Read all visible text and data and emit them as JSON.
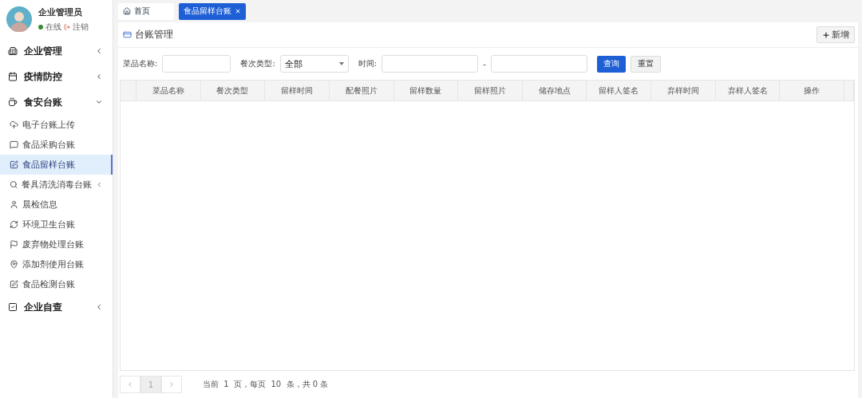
{
  "user": {
    "name": "企业管理员",
    "status": "在线",
    "logout": "注销"
  },
  "menu": [
    {
      "label": "企业管理",
      "expanded": false
    },
    {
      "label": "疫情防控",
      "expanded": false
    },
    {
      "label": "食安台账",
      "expanded": true,
      "children": [
        {
          "label": "电子台账上传",
          "selected": false
        },
        {
          "label": "食品采购台账",
          "selected": false
        },
        {
          "label": "食品留样台账",
          "selected": true
        },
        {
          "label": "餐具清洗消毒台账",
          "selected": false,
          "expanded": false
        },
        {
          "label": "晨检信息",
          "selected": false
        },
        {
          "label": "环境卫生台账",
          "selected": false
        },
        {
          "label": "废弃物处理台账",
          "selected": false
        },
        {
          "label": "添加剂使用台账",
          "selected": false
        },
        {
          "label": "食品检测台账",
          "selected": false
        }
      ]
    },
    {
      "label": "企业自查",
      "expanded": false
    }
  ],
  "tabs": [
    {
      "label": "首页",
      "selected": false
    },
    {
      "label": "食品留样台账",
      "selected": true
    }
  ],
  "panel": {
    "title": "台账管理",
    "add_button": "新增"
  },
  "filters": {
    "dish_label": "菜品名称:",
    "meal_label": "餐次类型:",
    "meal_value": "全部",
    "time_label": "时间:",
    "time_separator": "-",
    "query_button": "查询",
    "reset_button": "重置"
  },
  "table": {
    "columns": [
      "菜品名称",
      "餐次类型",
      "留样时间",
      "配餐照片",
      "留样数量",
      "留样照片",
      "储存地点",
      "留样人签名",
      "弃样时间",
      "弃样人签名",
      "操作"
    ]
  },
  "pagination": {
    "pages": [
      {
        "label": "1",
        "selected": true
      }
    ],
    "summary": "当前  1  页，每页  10  条，共 0 条"
  }
}
